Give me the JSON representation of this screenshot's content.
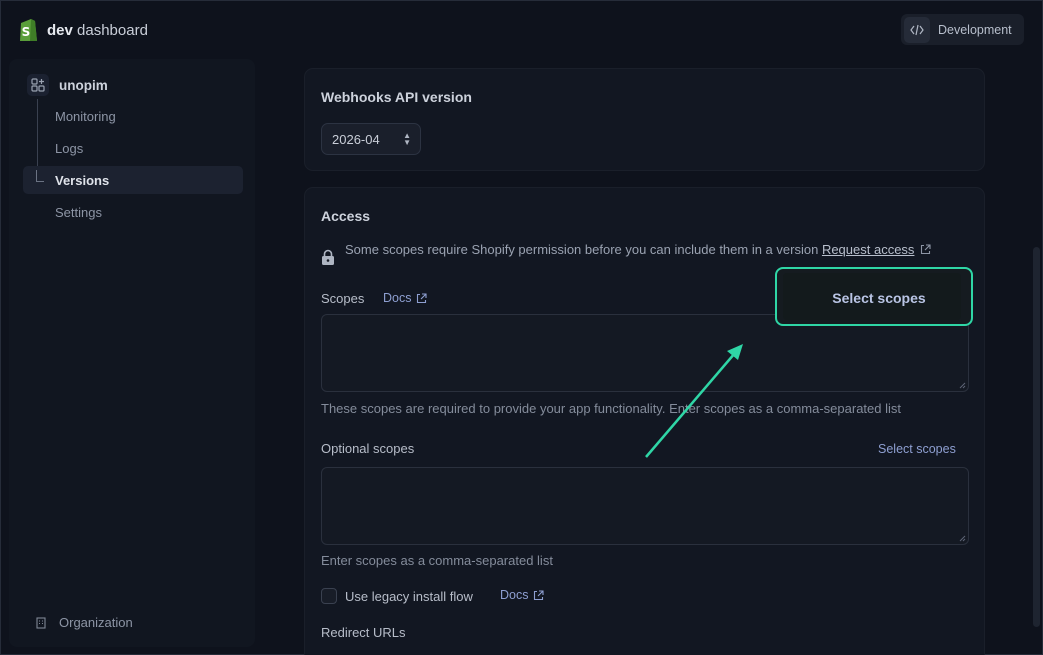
{
  "header": {
    "brand_bold": "dev",
    "brand_rest": " dashboard",
    "env_label": "Development",
    "env_icon": "code-icon"
  },
  "sidebar": {
    "app_name": "unopim",
    "app_icon": "apps-icon",
    "items": [
      {
        "label": "Monitoring"
      },
      {
        "label": "Logs"
      },
      {
        "label": "Versions",
        "active": true
      },
      {
        "label": "Settings"
      }
    ],
    "footer_label": "Organization",
    "footer_icon": "building-icon"
  },
  "webhooks": {
    "title": "Webhooks API version",
    "version": "2026-04"
  },
  "access": {
    "title": "Access",
    "notice": "Some scopes require Shopify permission before you can include them in a version",
    "notice_link": "Request access",
    "scopes_label": "Scopes",
    "docs_label": "Docs",
    "scopes_help": "These scopes are required to provide your app functionality. Enter scopes as a comma-separated list",
    "optional_label": "Optional scopes",
    "optional_select": "Select scopes",
    "optional_help": "Enter scopes as a comma-separated list",
    "legacy_label": "Use legacy install flow",
    "legacy_docs": "Docs",
    "redirect_label": "Redirect URLs"
  },
  "callout": {
    "label": "Select scopes",
    "color": "#2fd6a6"
  }
}
